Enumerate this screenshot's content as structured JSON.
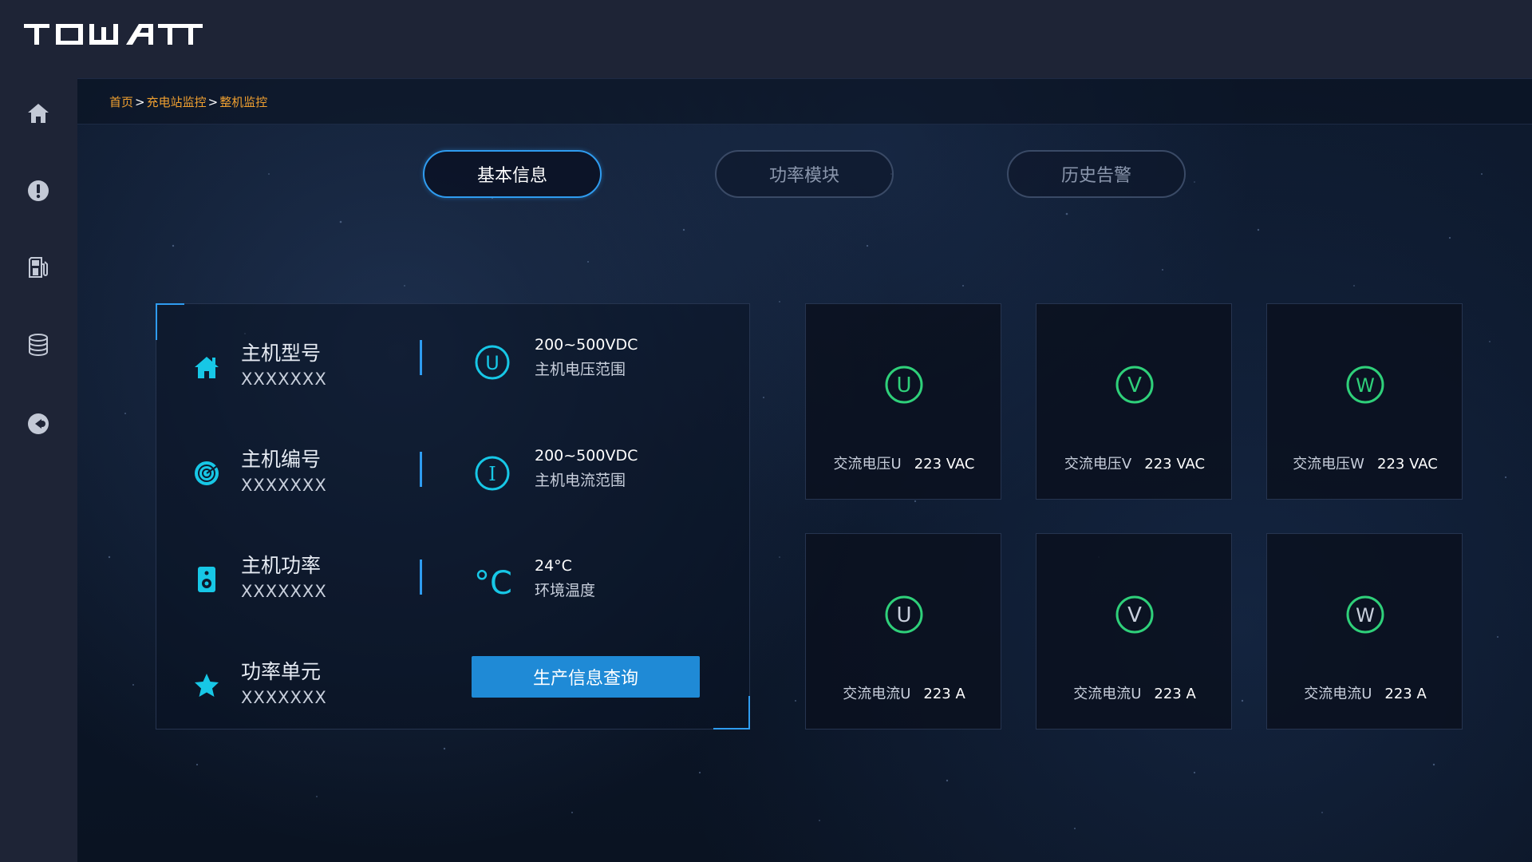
{
  "header": {
    "logo_text": "TOWATT"
  },
  "sidebar": {
    "items": [
      {
        "name": "home",
        "icon": "home-icon"
      },
      {
        "name": "alarm",
        "icon": "alert-icon"
      },
      {
        "name": "station",
        "icon": "fuel-station-icon"
      },
      {
        "name": "database",
        "icon": "database-icon"
      },
      {
        "name": "other",
        "icon": "circle-arrow-icon"
      }
    ]
  },
  "breadcrumb": {
    "items": [
      "首页",
      "充电站监控",
      "整机监控"
    ],
    "separator": ">"
  },
  "tabs": [
    {
      "label": "基本信息",
      "active": true
    },
    {
      "label": "功率模块",
      "active": false
    },
    {
      "label": "历史告警",
      "active": false
    }
  ],
  "info": {
    "rows": [
      {
        "label": "主机型号",
        "value": "XXXXXXX",
        "icon": "house-icon"
      },
      {
        "label": "主机编号",
        "value": "XXXXXXX",
        "icon": "target-icon"
      },
      {
        "label": "主机功率",
        "value": "XXXXXXX",
        "icon": "speaker-icon"
      },
      {
        "label": "功率单元",
        "value": "XXXXXXX",
        "icon": "star-icon"
      }
    ],
    "specs": [
      {
        "symbol": "U",
        "value": "200~500VDC",
        "desc": "主机电压范围",
        "icon": "voltage-u-icon"
      },
      {
        "symbol": "I",
        "value": "200~500VDC",
        "desc": "主机电流范围",
        "icon": "current-i-icon"
      },
      {
        "symbol": "°C",
        "value": "24°C",
        "desc": "环境温度",
        "icon": "celsius-icon"
      }
    ],
    "query_button": "生产信息查询"
  },
  "cards": [
    {
      "symbol": "U",
      "name": "交流电压U",
      "value": "223 VAC"
    },
    {
      "symbol": "V",
      "name": "交流电压V",
      "value": "223 VAC"
    },
    {
      "symbol": "W",
      "name": "交流电压W",
      "value": "223 VAC"
    },
    {
      "symbol": "U",
      "name": "交流电流U",
      "value": "223 A"
    },
    {
      "symbol": "V",
      "name": "交流电流U",
      "value": "223 A"
    },
    {
      "symbol": "W",
      "name": "交流电流U",
      "value": "223 A"
    }
  ],
  "colors": {
    "accent": "#2f9cf0",
    "cyan": "#17c7e6",
    "green": "#2fd07a",
    "breadcrumb": "#f0a030",
    "button": "#1f8ad6"
  }
}
